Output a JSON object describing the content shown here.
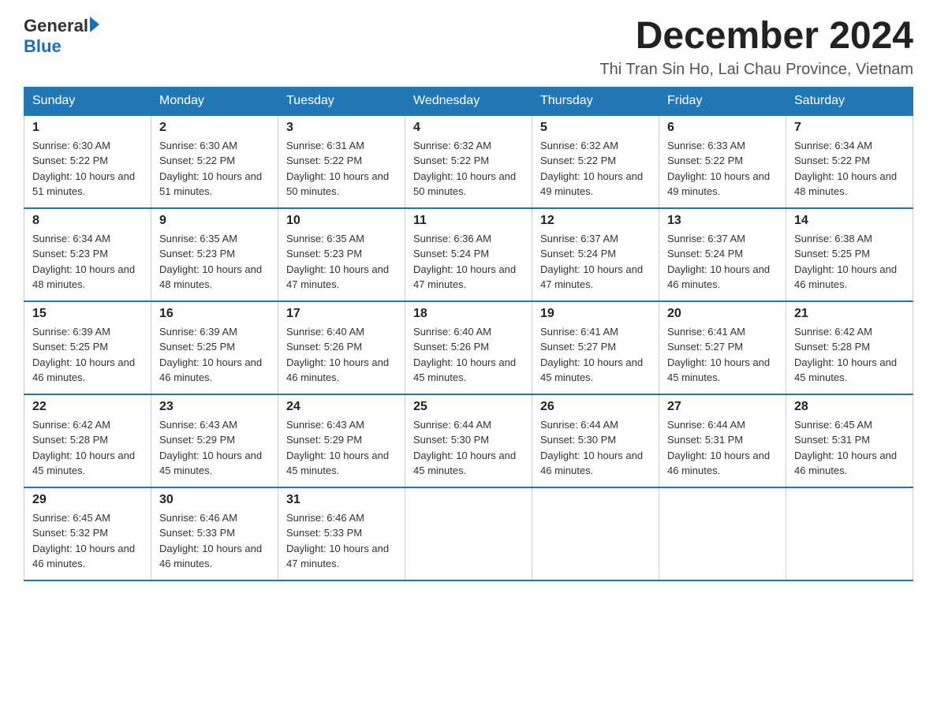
{
  "header": {
    "logo_general": "General",
    "logo_blue": "Blue",
    "month_title": "December 2024",
    "location": "Thi Tran Sin Ho, Lai Chau Province, Vietnam"
  },
  "days_of_week": [
    "Sunday",
    "Monday",
    "Tuesday",
    "Wednesday",
    "Thursday",
    "Friday",
    "Saturday"
  ],
  "weeks": [
    [
      {
        "day": "1",
        "sunrise": "6:30 AM",
        "sunset": "5:22 PM",
        "daylight": "10 hours and 51 minutes."
      },
      {
        "day": "2",
        "sunrise": "6:30 AM",
        "sunset": "5:22 PM",
        "daylight": "10 hours and 51 minutes."
      },
      {
        "day": "3",
        "sunrise": "6:31 AM",
        "sunset": "5:22 PM",
        "daylight": "10 hours and 50 minutes."
      },
      {
        "day": "4",
        "sunrise": "6:32 AM",
        "sunset": "5:22 PM",
        "daylight": "10 hours and 50 minutes."
      },
      {
        "day": "5",
        "sunrise": "6:32 AM",
        "sunset": "5:22 PM",
        "daylight": "10 hours and 49 minutes."
      },
      {
        "day": "6",
        "sunrise": "6:33 AM",
        "sunset": "5:22 PM",
        "daylight": "10 hours and 49 minutes."
      },
      {
        "day": "7",
        "sunrise": "6:34 AM",
        "sunset": "5:22 PM",
        "daylight": "10 hours and 48 minutes."
      }
    ],
    [
      {
        "day": "8",
        "sunrise": "6:34 AM",
        "sunset": "5:23 PM",
        "daylight": "10 hours and 48 minutes."
      },
      {
        "day": "9",
        "sunrise": "6:35 AM",
        "sunset": "5:23 PM",
        "daylight": "10 hours and 48 minutes."
      },
      {
        "day": "10",
        "sunrise": "6:35 AM",
        "sunset": "5:23 PM",
        "daylight": "10 hours and 47 minutes."
      },
      {
        "day": "11",
        "sunrise": "6:36 AM",
        "sunset": "5:24 PM",
        "daylight": "10 hours and 47 minutes."
      },
      {
        "day": "12",
        "sunrise": "6:37 AM",
        "sunset": "5:24 PM",
        "daylight": "10 hours and 47 minutes."
      },
      {
        "day": "13",
        "sunrise": "6:37 AM",
        "sunset": "5:24 PM",
        "daylight": "10 hours and 46 minutes."
      },
      {
        "day": "14",
        "sunrise": "6:38 AM",
        "sunset": "5:25 PM",
        "daylight": "10 hours and 46 minutes."
      }
    ],
    [
      {
        "day": "15",
        "sunrise": "6:39 AM",
        "sunset": "5:25 PM",
        "daylight": "10 hours and 46 minutes."
      },
      {
        "day": "16",
        "sunrise": "6:39 AM",
        "sunset": "5:25 PM",
        "daylight": "10 hours and 46 minutes."
      },
      {
        "day": "17",
        "sunrise": "6:40 AM",
        "sunset": "5:26 PM",
        "daylight": "10 hours and 46 minutes."
      },
      {
        "day": "18",
        "sunrise": "6:40 AM",
        "sunset": "5:26 PM",
        "daylight": "10 hours and 45 minutes."
      },
      {
        "day": "19",
        "sunrise": "6:41 AM",
        "sunset": "5:27 PM",
        "daylight": "10 hours and 45 minutes."
      },
      {
        "day": "20",
        "sunrise": "6:41 AM",
        "sunset": "5:27 PM",
        "daylight": "10 hours and 45 minutes."
      },
      {
        "day": "21",
        "sunrise": "6:42 AM",
        "sunset": "5:28 PM",
        "daylight": "10 hours and 45 minutes."
      }
    ],
    [
      {
        "day": "22",
        "sunrise": "6:42 AM",
        "sunset": "5:28 PM",
        "daylight": "10 hours and 45 minutes."
      },
      {
        "day": "23",
        "sunrise": "6:43 AM",
        "sunset": "5:29 PM",
        "daylight": "10 hours and 45 minutes."
      },
      {
        "day": "24",
        "sunrise": "6:43 AM",
        "sunset": "5:29 PM",
        "daylight": "10 hours and 45 minutes."
      },
      {
        "day": "25",
        "sunrise": "6:44 AM",
        "sunset": "5:30 PM",
        "daylight": "10 hours and 45 minutes."
      },
      {
        "day": "26",
        "sunrise": "6:44 AM",
        "sunset": "5:30 PM",
        "daylight": "10 hours and 46 minutes."
      },
      {
        "day": "27",
        "sunrise": "6:44 AM",
        "sunset": "5:31 PM",
        "daylight": "10 hours and 46 minutes."
      },
      {
        "day": "28",
        "sunrise": "6:45 AM",
        "sunset": "5:31 PM",
        "daylight": "10 hours and 46 minutes."
      }
    ],
    [
      {
        "day": "29",
        "sunrise": "6:45 AM",
        "sunset": "5:32 PM",
        "daylight": "10 hours and 46 minutes."
      },
      {
        "day": "30",
        "sunrise": "6:46 AM",
        "sunset": "5:33 PM",
        "daylight": "10 hours and 46 minutes."
      },
      {
        "day": "31",
        "sunrise": "6:46 AM",
        "sunset": "5:33 PM",
        "daylight": "10 hours and 47 minutes."
      },
      null,
      null,
      null,
      null
    ]
  ],
  "labels": {
    "sunrise_prefix": "Sunrise: ",
    "sunset_prefix": "Sunset: ",
    "daylight_prefix": "Daylight: "
  }
}
